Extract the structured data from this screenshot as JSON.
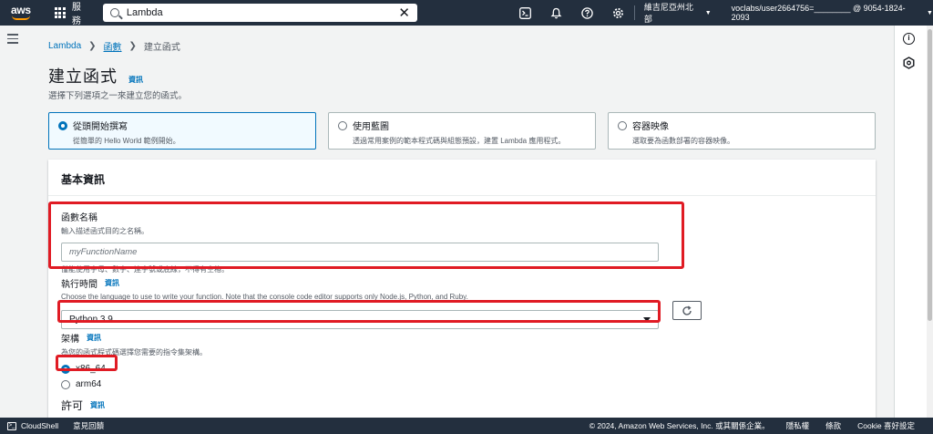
{
  "nav": {
    "logo": "aws",
    "services": "服務",
    "search_value": "Lambda",
    "region": "維吉尼亞州北部",
    "account": "voclabs/user2664756=________ @ 9054-1824-2093"
  },
  "breadcrumb": {
    "root": "Lambda",
    "functions": "函數",
    "current": "建立函式"
  },
  "page": {
    "title": "建立函式",
    "info": "資訊",
    "subtitle": "選擇下列選項之一來建立您的函式。"
  },
  "options": [
    {
      "title": "從頭開始撰寫",
      "desc": "從簡單的 Hello World 範例開始。",
      "selected": true
    },
    {
      "title": "使用藍圖",
      "desc": "透過常用案例的範本程式碼與組態預設，建置 Lambda 應用程式。",
      "selected": false
    },
    {
      "title": "容器映像",
      "desc": "選取要為函數部署的容器映像。",
      "selected": false
    }
  ],
  "basic": {
    "heading": "基本資訊",
    "fn_name": {
      "label": "函數名稱",
      "desc": "輸入描述函式目的之名稱。",
      "placeholder": "myFunctionName",
      "hint": "僅能使用字母、數字、連字號或底線，不得有空格。"
    },
    "runtime": {
      "label": "執行時間",
      "info": "資訊",
      "desc": "Choose the language to use to write your function. Note that the console code editor supports only Node.js, Python, and Ruby.",
      "value": "Python 3.9"
    },
    "arch": {
      "label": "架構",
      "info": "資訊",
      "desc": "為您的函式程式碼選擇您需要的指令集架構。",
      "options": [
        {
          "label": "x86_64",
          "selected": true
        },
        {
          "label": "arm64",
          "selected": false
        }
      ]
    },
    "permissions": {
      "label": "許可",
      "info": "資訊"
    }
  },
  "footer": {
    "cloudshell": "CloudShell",
    "feedback": "意見回饋",
    "copyright": "© 2024, Amazon Web Services, Inc. 或其關係企業。",
    "privacy": "隱私權",
    "terms": "條款",
    "cookie": "Cookie 喜好設定"
  }
}
